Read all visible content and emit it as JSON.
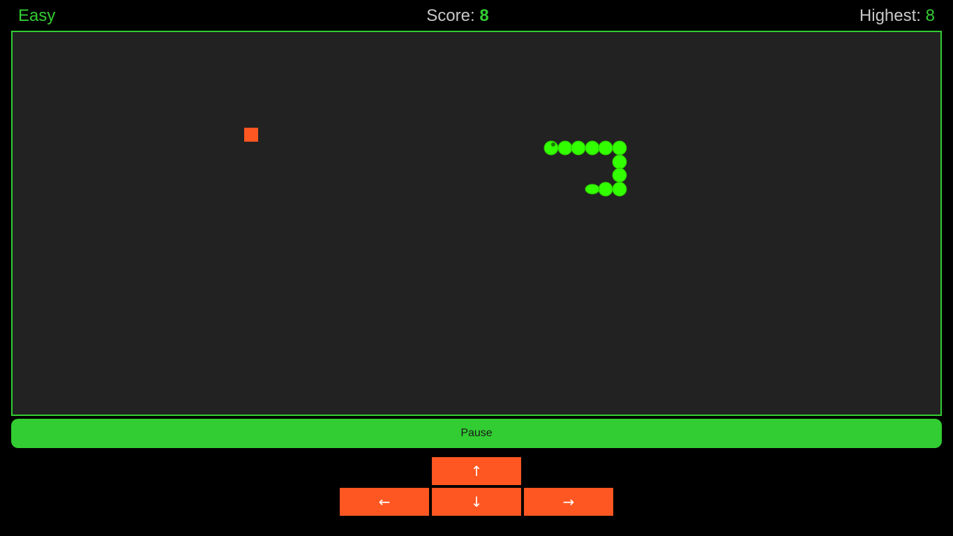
{
  "header": {
    "difficulty": "Easy",
    "score_label": "Score: ",
    "score_value": "8",
    "highest_label": "Highest: ",
    "highest_value": "8"
  },
  "game": {
    "colors": {
      "background": "#222222",
      "border": "#32cd32",
      "snake": "#32ff00",
      "snake_outline": "#2ab800",
      "food": "#ff5722"
    }
  },
  "controls": {
    "pause_label": "Pause",
    "up_label": "↑",
    "left_label": "←",
    "down_label": "↓",
    "right_label": "→"
  }
}
